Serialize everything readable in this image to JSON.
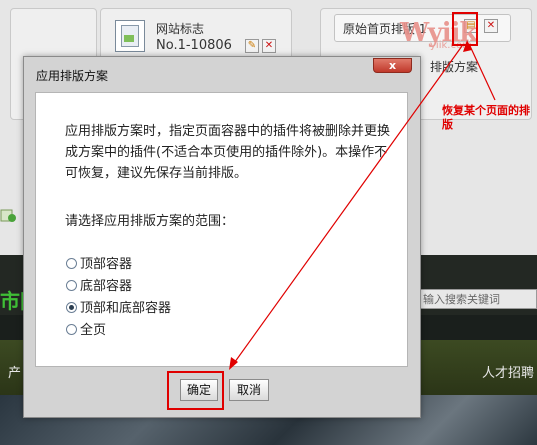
{
  "background": {
    "widget": {
      "title": "网站标志",
      "id": "No.1-10806"
    },
    "layout_card": {
      "label": "原始首页排版 1",
      "sublabel": "排版方案"
    },
    "search_placeholder": "输入搜索关键词",
    "nav_left": "产",
    "nav_right": "人才招聘",
    "logo_fragment": "市网",
    "watermark": {
      "main": "Wyiik",
      "sub": "yiik.com"
    }
  },
  "annotation": {
    "note": "恢复某个页面的排版"
  },
  "dialog": {
    "title": "应用排版方案",
    "close_label": "x",
    "message": "应用排版方案时，指定页面容器中的插件将被删除并更换成方案中的插件(不适合本页使用的插件除外)。本操作不可恢复，建议先保存当前排版。",
    "prompt": "请选择应用排版方案的范围：",
    "options": [
      {
        "label": "顶部容器",
        "selected": false
      },
      {
        "label": "底部容器",
        "selected": false
      },
      {
        "label": "顶部和底部容器",
        "selected": true
      },
      {
        "label": "全页",
        "selected": false
      }
    ],
    "confirm_label": "确定",
    "cancel_label": "取消"
  },
  "colors": {
    "annotation_red": "#e00000",
    "close_red": "#c0392b"
  },
  "icons": [
    "page-icon",
    "edit-icon",
    "delete-icon",
    "close-icon",
    "arrow-icon"
  ]
}
